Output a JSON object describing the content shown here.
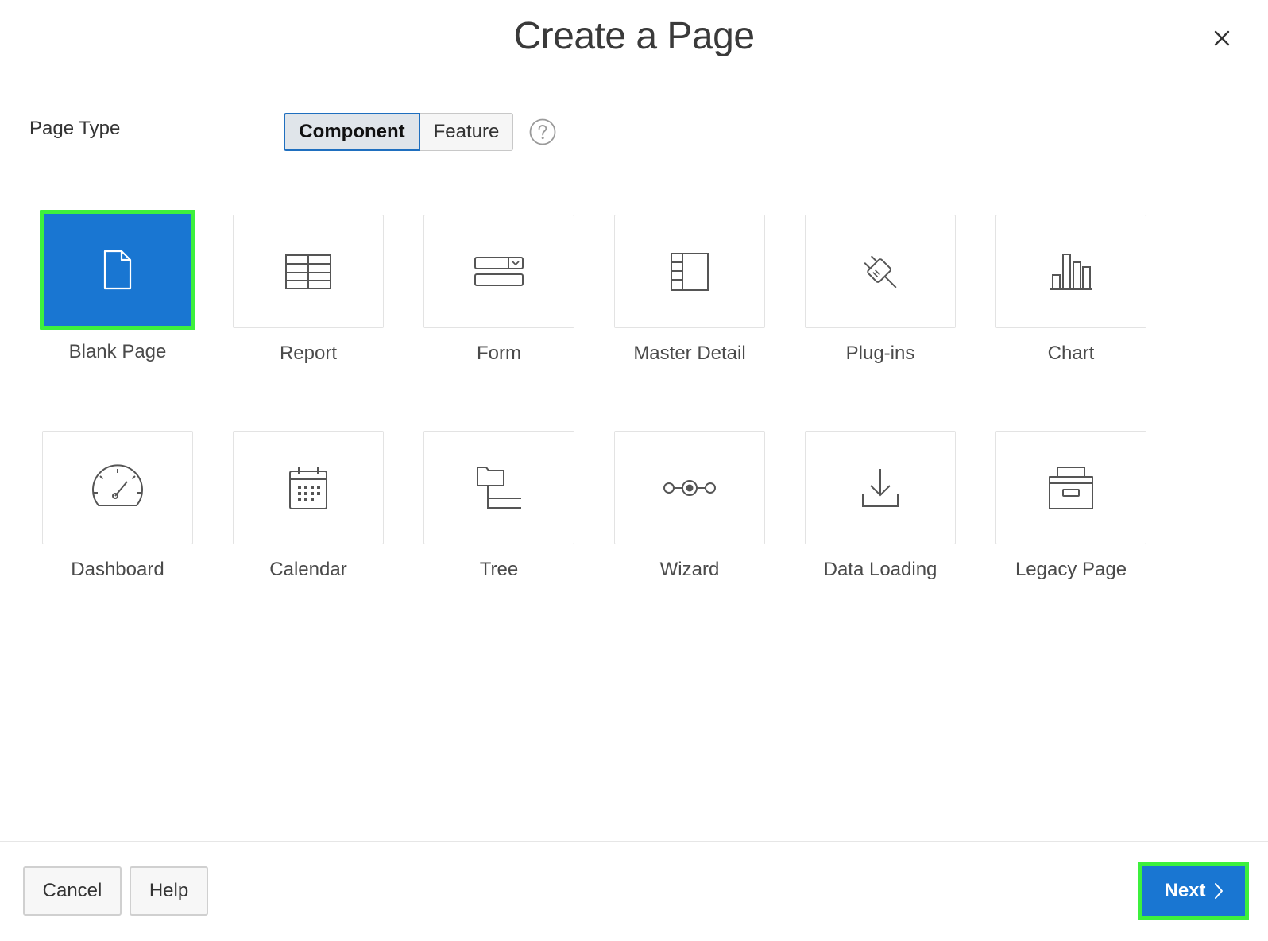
{
  "dialog": {
    "title": "Create a Page",
    "close_icon": "close-icon"
  },
  "page_type": {
    "label": "Page Type",
    "options": [
      "Component",
      "Feature"
    ],
    "selected": "Component",
    "help_icon": "help-icon"
  },
  "tiles": [
    {
      "label": "Blank Page",
      "icon": "blank-page-icon",
      "selected": true
    },
    {
      "label": "Report",
      "icon": "report-table-icon",
      "selected": false
    },
    {
      "label": "Form",
      "icon": "form-icon",
      "selected": false
    },
    {
      "label": "Master Detail",
      "icon": "master-detail-icon",
      "selected": false
    },
    {
      "label": "Plug-ins",
      "icon": "plug-icon",
      "selected": false
    },
    {
      "label": "Chart",
      "icon": "bar-chart-icon",
      "selected": false
    },
    {
      "label": "Dashboard",
      "icon": "speedometer-icon",
      "selected": false
    },
    {
      "label": "Calendar",
      "icon": "calendar-icon",
      "selected": false
    },
    {
      "label": "Tree",
      "icon": "tree-icon",
      "selected": false
    },
    {
      "label": "Wizard",
      "icon": "wizard-steps-icon",
      "selected": false
    },
    {
      "label": "Data Loading",
      "icon": "download-tray-icon",
      "selected": false
    },
    {
      "label": "Legacy Page",
      "icon": "archive-box-icon",
      "selected": false
    }
  ],
  "footer": {
    "cancel_label": "Cancel",
    "help_label": "Help",
    "next_label": "Next",
    "next_icon": "chevron-right-icon"
  },
  "colors": {
    "accent": "#1976d2",
    "highlight": "#3df03d",
    "tile_border": "#e3e3e3"
  }
}
